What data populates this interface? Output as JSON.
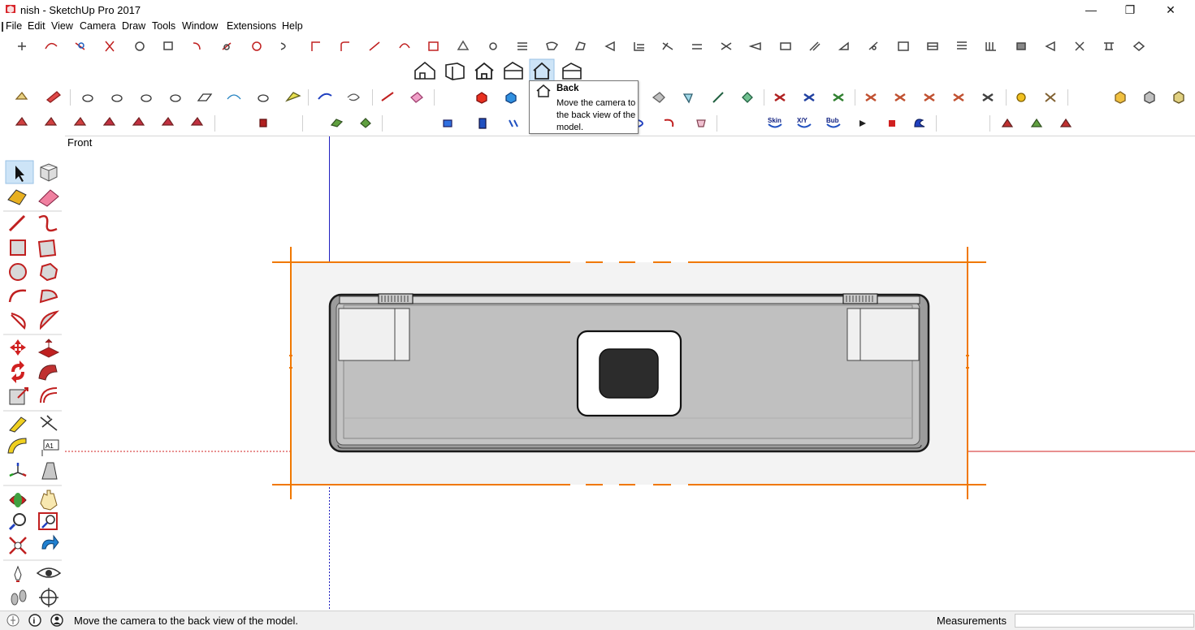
{
  "window": {
    "title": "nish - SketchUp Pro 2017",
    "minimize": "—",
    "maximize": "❐",
    "close": "✕"
  },
  "menu": [
    "File",
    "Edit",
    "View",
    "Camera",
    "Draw",
    "Tools",
    "Window",
    "Extensions",
    "Help"
  ],
  "tooltip": {
    "title": "Back",
    "description": "Move the camera to the back view of the model."
  },
  "toolbar_text_labels": {
    "skin": "Skin",
    "xy": "X/Y",
    "bub": "Bub"
  },
  "viewport": {
    "label": "Front"
  },
  "statusbar": {
    "message": "Move the camera to the back view of the model.",
    "measurements_label": "Measurements",
    "measurements_value": ""
  },
  "colors": {
    "accent_orange": "#f07800",
    "axis_red": "#d02020",
    "axis_blue": "#2020c0",
    "axis_green": "#20a020",
    "model_gray": "#c4c4c4",
    "model_dark": "#2c2c2c"
  },
  "icons": {
    "views": [
      "iso-view-icon",
      "top-view-icon",
      "front-view-icon",
      "right-view-icon",
      "back-view-icon",
      "left-view-icon"
    ],
    "left_toolbar": [
      "select-icon",
      "component-icon",
      "paint-bucket-icon",
      "eraser-icon",
      "line-icon",
      "freehand-icon",
      "rectangle-icon",
      "rotated-rectangle-icon",
      "circle-icon",
      "polygon-icon",
      "arc-icon",
      "pie-icon",
      "two-point-arc-icon",
      "three-point-arc-icon",
      "move-icon",
      "push-pull-icon",
      "rotate-icon",
      "follow-me-icon",
      "scale-icon",
      "offset-icon",
      "tape-measure-icon",
      "dimension-icon",
      "protractor-icon",
      "text-icon",
      "axes-icon",
      "3d-text-icon",
      "orbit-icon",
      "pan-icon",
      "zoom-icon",
      "zoom-window-icon",
      "zoom-extents-icon",
      "previous-view-icon",
      "position-camera-icon",
      "look-around-icon",
      "walk-icon",
      "section-plane-icon"
    ]
  }
}
